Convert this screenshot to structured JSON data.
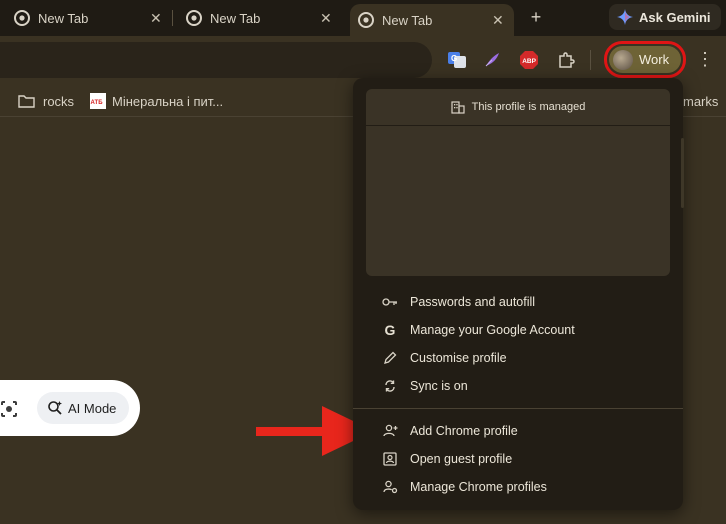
{
  "tabs": [
    {
      "label": "New Tab",
      "active": false
    },
    {
      "label": "New Tab",
      "active": false
    },
    {
      "label": "New Tab",
      "active": true
    }
  ],
  "tab_close_glyph": "✕",
  "new_tab_glyph": "+",
  "gemini_label": "Ask Gemini",
  "toolbar": {
    "extensions": [
      "google-translate-icon",
      "feather-icon",
      "adblock-plus-icon",
      "puzzle-extensions-icon"
    ],
    "abp_text": "ABP",
    "profile_label": "Work",
    "more_glyph": "⋮"
  },
  "bookmarks": [
    {
      "label": "rocks",
      "icon": "folder-icon"
    },
    {
      "label": "Мінеральна і пит...",
      "icon": "atb-favicon"
    }
  ],
  "bookmarks_overflow": "marks",
  "atb_text": "АТБ",
  "search": {
    "ai_mode_label": "AI Mode"
  },
  "profile_menu": {
    "managed_text": "This profile is managed",
    "items": [
      {
        "label": "Passwords and autofill",
        "icon": "key-icon"
      },
      {
        "label": "Manage your Google Account",
        "icon": "google-g-icon"
      },
      {
        "label": "Customise profile",
        "icon": "pencil-icon"
      },
      {
        "label": "Sync is on",
        "icon": "sync-icon"
      }
    ],
    "items2": [
      {
        "label": "Add Chrome profile",
        "icon": "add-person-icon"
      },
      {
        "label": "Open guest profile",
        "icon": "guest-profile-icon"
      },
      {
        "label": "Manage Chrome profiles",
        "icon": "manage-profiles-icon"
      }
    ]
  },
  "colors": {
    "highlight_ring": "#e01515",
    "arrow": "#e8261c",
    "background": "#3a3222"
  }
}
